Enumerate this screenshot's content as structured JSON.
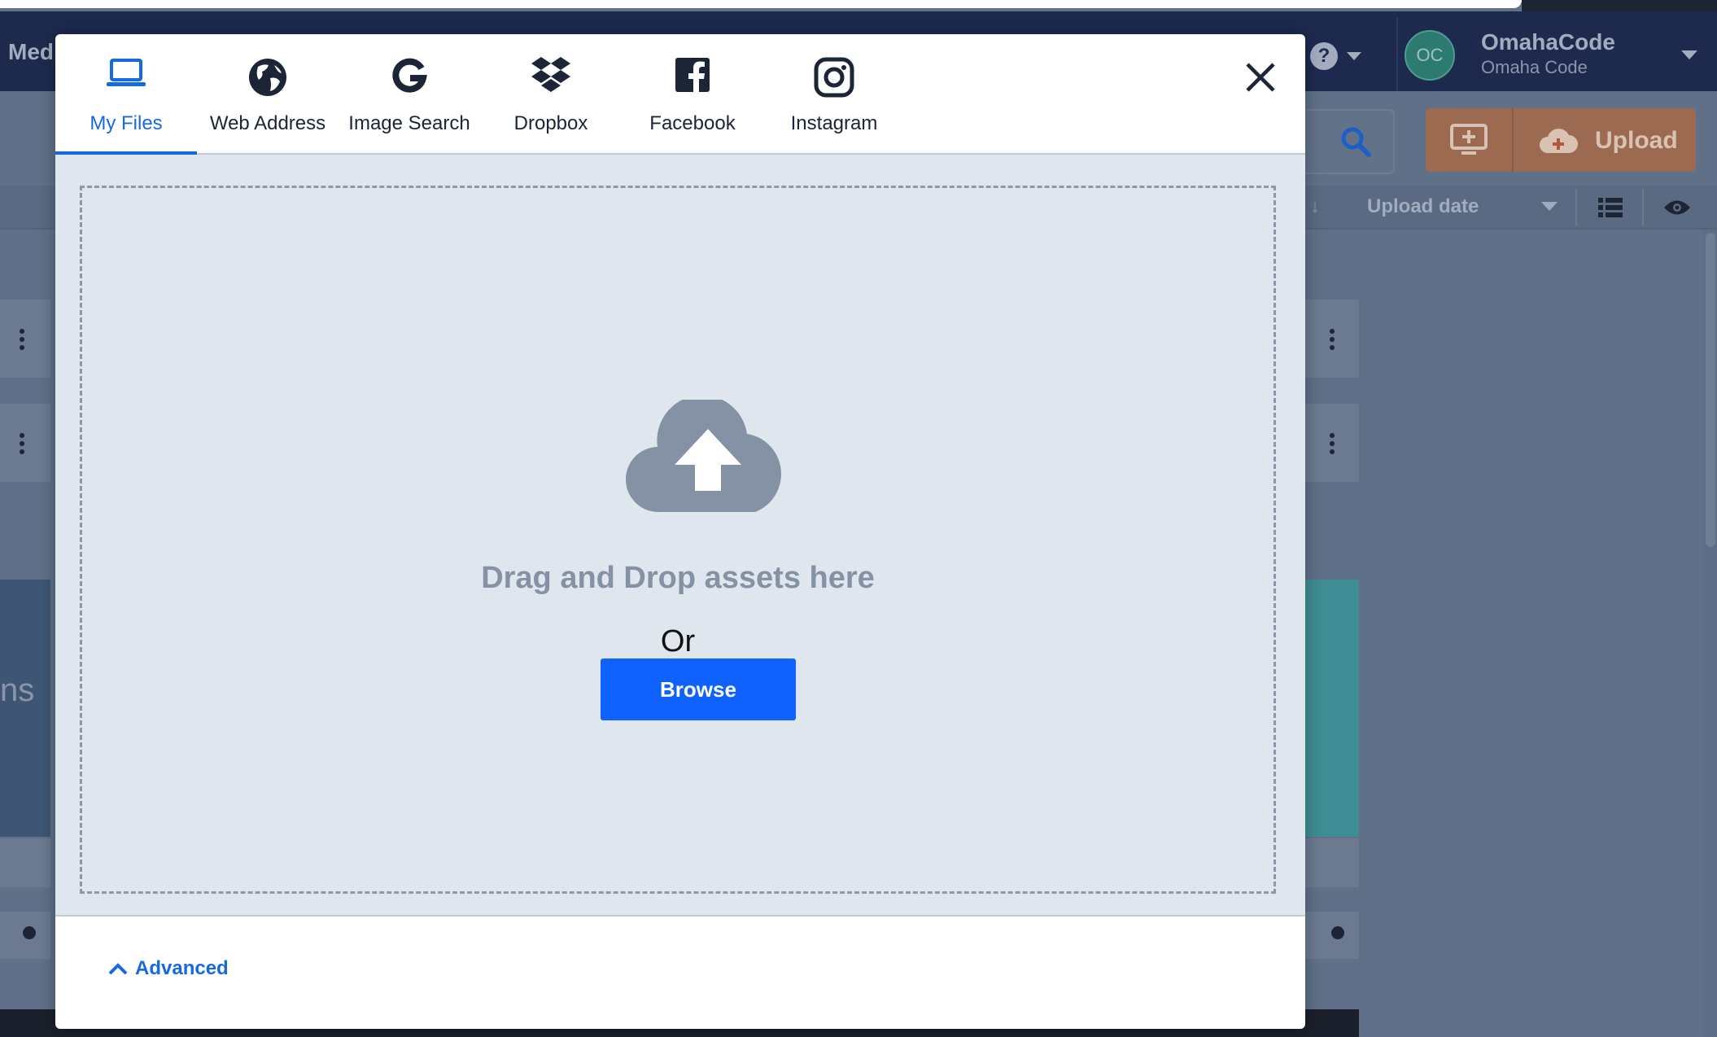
{
  "background": {
    "app_title": "Medi",
    "help_label": "?",
    "user": {
      "initials": "OC",
      "name": "OmahaCode",
      "org": "Omaha Code"
    },
    "upload_button": "Upload",
    "sort_label": "Upload date",
    "sort_arrow": "↓",
    "left_partial_text": "ns"
  },
  "modal": {
    "tabs": [
      {
        "label": "My Files",
        "icon": "laptop-icon",
        "active": true
      },
      {
        "label": "Web Address",
        "icon": "globe-icon"
      },
      {
        "label": "Image Search",
        "icon": "google-icon"
      },
      {
        "label": "Dropbox",
        "icon": "dropbox-icon"
      },
      {
        "label": "Facebook",
        "icon": "facebook-icon"
      },
      {
        "label": "Instagram",
        "icon": "instagram-icon"
      }
    ],
    "drop_title": "Drag and Drop assets here",
    "or_text": "Or",
    "browse_label": "Browse",
    "advanced_label": "Advanced"
  },
  "colors": {
    "accent": "#1769e0",
    "browse": "#0f62fe",
    "drop_bg": "#dfe6ee",
    "cloud": "#8591a5"
  }
}
